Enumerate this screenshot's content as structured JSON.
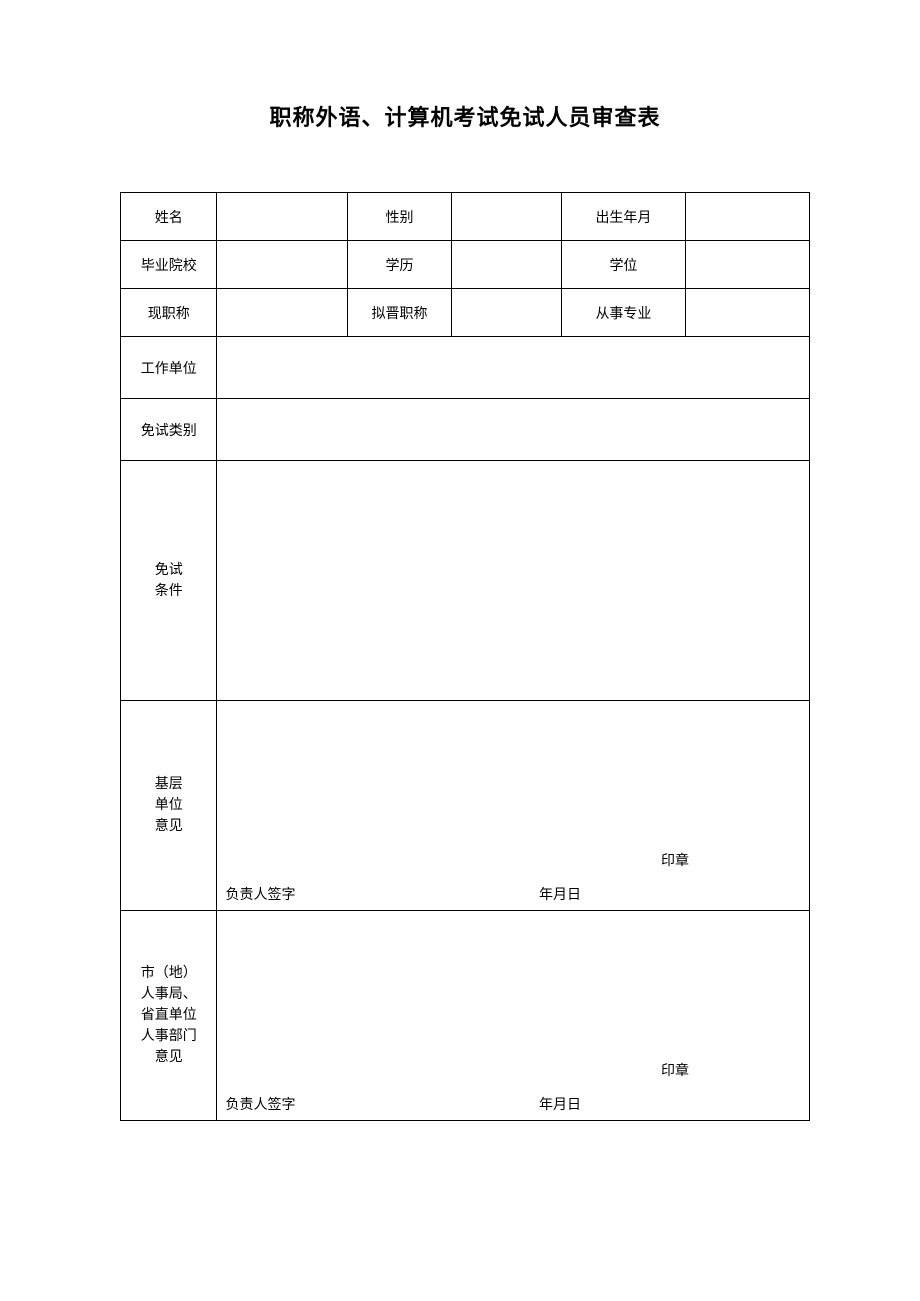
{
  "title": "职称外语、计算机考试免试人员审查表",
  "labels": {
    "name": "姓名",
    "gender": "性别",
    "dob": "出生年月",
    "school": "毕业院校",
    "education": "学历",
    "degree": "学位",
    "currentTitle": "现职称",
    "proposedTitle": "拟晋职称",
    "major": "从事专业",
    "workUnit": "工作单位",
    "exemptCategory": "免试类别",
    "exemptCond1": "免试",
    "exemptCond2": "条件",
    "baseUnit1": "基层",
    "baseUnit2": "单位",
    "baseUnit3": "意见",
    "cityDept1": "市（地）",
    "cityDept2": "人事局、",
    "cityDept3": "省直单位",
    "cityDept4": "人事部门",
    "cityDept5": "意见",
    "stamp": "印章",
    "signLabel": "负责人签字",
    "dateLabel": "年月日"
  },
  "values": {
    "name": "",
    "gender": "",
    "dob": "",
    "school": "",
    "education": "",
    "degree": "",
    "currentTitle": "",
    "proposedTitle": "",
    "major": "",
    "workUnit": "",
    "exemptCategory": "",
    "exemptConditions": "",
    "baseUnitOpinion": "",
    "cityDeptOpinion": ""
  }
}
